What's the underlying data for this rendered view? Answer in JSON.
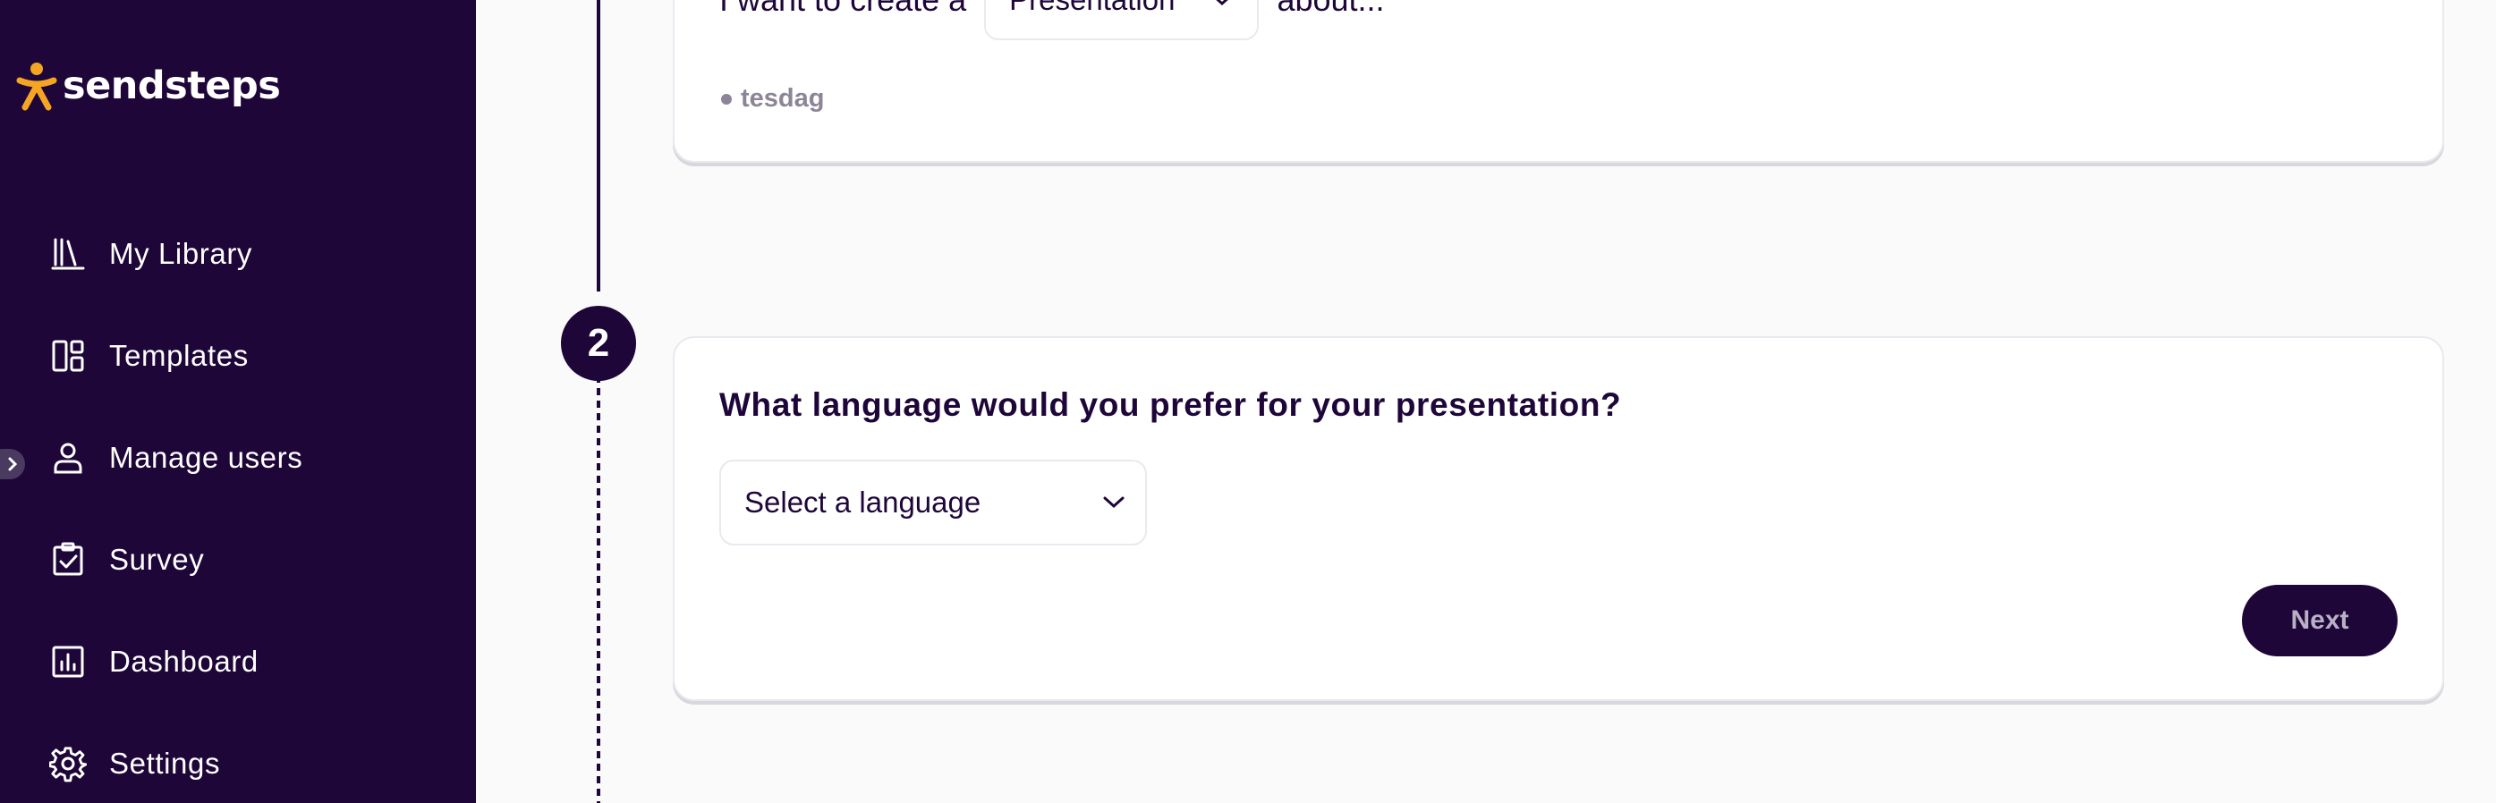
{
  "brand": {
    "name": "sendsteps",
    "accent": "#f5a524",
    "sidebar_bg": "#1e0639"
  },
  "sidebar": {
    "collapse_icon": "chevron-right-icon",
    "items": [
      {
        "label": "My Library",
        "icon": "library-icon"
      },
      {
        "label": "Templates",
        "icon": "templates-icon"
      },
      {
        "label": "Manage users",
        "icon": "user-icon"
      },
      {
        "label": "Survey",
        "icon": "clipboard-check-icon"
      },
      {
        "label": "Dashboard",
        "icon": "chart-icon"
      },
      {
        "label": "Settings",
        "icon": "gear-icon"
      }
    ]
  },
  "step1": {
    "prefix": "I want to create a",
    "type_value": "Presentation",
    "suffix": "about...",
    "tag": "tesdag"
  },
  "step2": {
    "number": "2",
    "question": "What language would you prefer for your presentation?",
    "language_placeholder": "Select a language",
    "next_label": "Next"
  }
}
